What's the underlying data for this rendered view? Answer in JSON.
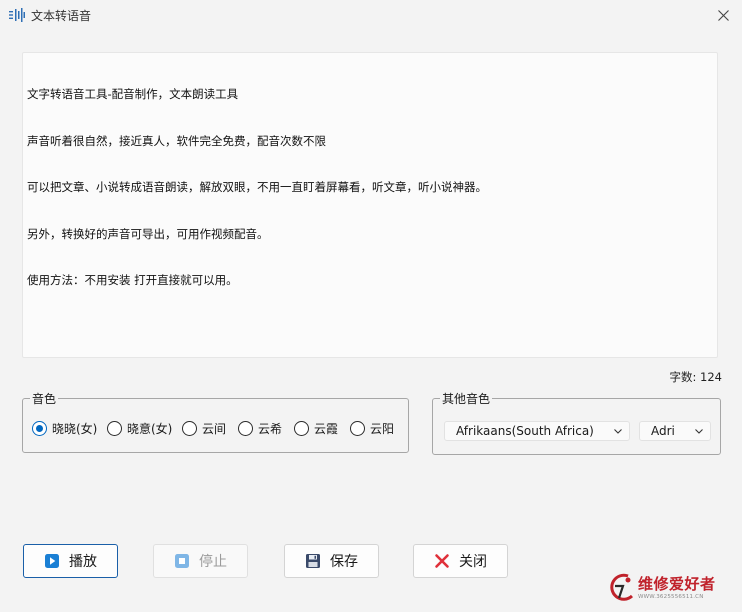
{
  "window": {
    "title": "文本转语音"
  },
  "editor": {
    "lines": [
      "文字转语音工具-配音制作，文本朗读工具",
      "声音听着很自然，接近真人，软件完全免费，配音次数不限",
      "可以把文章、小说转成语音朗读，解放双眼，不用一直盯着屏幕看，听文章，听小说神器。",
      "另外，转换好的声音可导出，可用作视频配音。",
      "使用方法：不用安装 打开直接就可以用。"
    ]
  },
  "char_count": {
    "label": "字数:",
    "value": "124"
  },
  "voice_group": {
    "legend": "音色",
    "options": [
      "晓晓(女)",
      "晓意(女)",
      "云间",
      "云希",
      "云霞",
      "云阳"
    ],
    "selected_index": 0
  },
  "other_voice": {
    "legend": "其他音色",
    "language": "Afrikaans(South Africa)",
    "voice": "Adri"
  },
  "buttons": {
    "play": "播放",
    "stop": "停止",
    "save": "保存",
    "close": "关闭"
  },
  "watermark": {
    "name": "维修爱好者",
    "url": "WWW.3625556511.CN"
  },
  "colors": {
    "accent": "#0067c0",
    "close_red": "#e0303a",
    "watermark_red": "#c0222b"
  }
}
